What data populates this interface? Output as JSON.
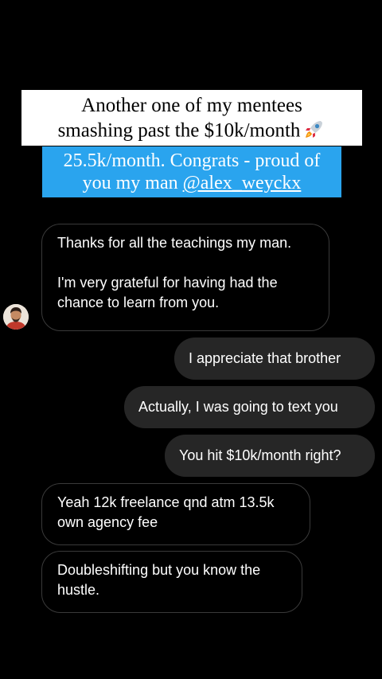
{
  "story": {
    "caption_line1": "Another one of my mentees",
    "caption_line2": "smashing past the $10k/month",
    "caption_emoji": "rocket-icon",
    "highlight_line1": "25.5k/month. Congrats - proud of",
    "highlight_line2_prefix": "you my man ",
    "highlight_mention": "@alex_weyckx"
  },
  "messages": [
    {
      "sender": "them",
      "text_line1": "Thanks for all the teachings my man.",
      "text_line2": "I'm very grateful for having had the chance to learn from you."
    },
    {
      "sender": "me",
      "text": "I appreciate that brother"
    },
    {
      "sender": "me",
      "text": "Actually, I was going to text you"
    },
    {
      "sender": "me",
      "text": "You hit $10k/month right?"
    },
    {
      "sender": "them",
      "text": "Yeah 12k freelance qnd atm 13.5k own agency fee"
    },
    {
      "sender": "them",
      "text": "Doubleshifting but you know the hustle."
    }
  ],
  "colors": {
    "background": "#000000",
    "highlight": "#2aa4ee",
    "sent_bubble": "#262626",
    "received_border": "#3a3a3a"
  }
}
